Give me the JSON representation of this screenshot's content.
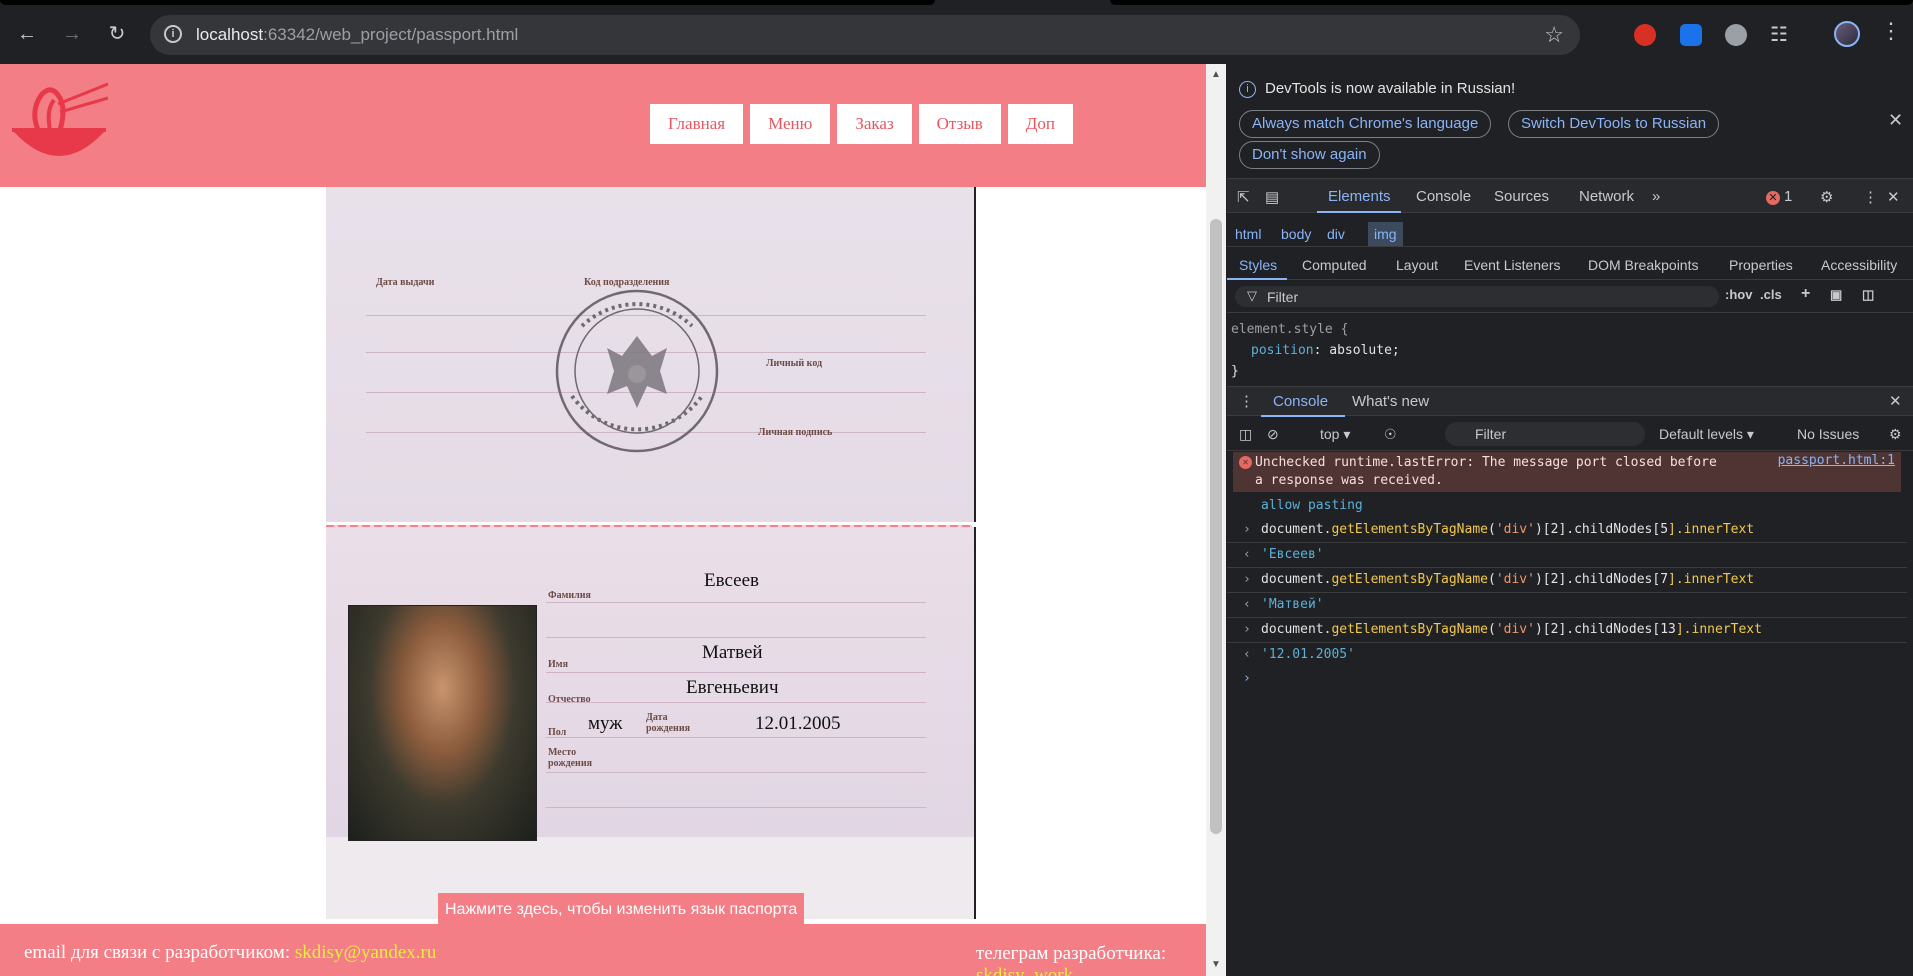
{
  "browser": {
    "url_host": "localhost",
    "url_rest": ":63342/web_project/passport.html"
  },
  "site": {
    "nav": [
      "Главная",
      "Меню",
      "Заказ",
      "Отзыв",
      "Доп"
    ],
    "passport": {
      "labels": {
        "issue_date": "Дата выдачи",
        "division_code": "Код подразделения",
        "personal_code": "Личный код",
        "signature": "Личная подпись",
        "surname": "Фамилия",
        "name": "Имя",
        "patronymic": "Отчество",
        "sex": "Пол",
        "birth_date": "Дата рождения",
        "birth_place": "Место рождения"
      },
      "surname": "Евсеев",
      "name": "Матвей",
      "patronymic": "Евгеньевич",
      "sex": "муж",
      "birth_date": "12.01.2005"
    },
    "lang_button": "Нажмите здесь, чтобы изменить язык паспорта",
    "footer": {
      "email_label": "email для связи с разработчиком: ",
      "email": "skdisy@yandex.ru",
      "telegram_label": "телеграм разработчика:",
      "telegram": "skdisy_work"
    }
  },
  "devtools": {
    "infobar_text": "DevTools is now available in Russian!",
    "btn_match": "Always match Chrome's language",
    "btn_switch": "Switch DevTools to Russian",
    "btn_dont_show": "Don't show again",
    "tabs": [
      "Elements",
      "Console",
      "Sources",
      "Network"
    ],
    "error_count": "1",
    "breadcrumbs": [
      "html",
      "body",
      "div",
      "img"
    ],
    "subtabs": [
      "Styles",
      "Computed",
      "Layout",
      "Event Listeners",
      "DOM Breakpoints",
      "Properties",
      "Accessibility"
    ],
    "filter_placeholder": "Filter",
    "hov": ":hov",
    "cls": ".cls",
    "styles": {
      "selector": "element.style {",
      "prop": "position",
      "value": "absolute;",
      "close": "}"
    },
    "drawer_tabs": [
      "Console",
      "What's new"
    ],
    "console_context": "top",
    "console_filter": "Filter",
    "default_levels": "Default levels",
    "no_issues": "No Issues",
    "console": {
      "error_text_1": "Unchecked runtime.lastError: The message port closed before",
      "error_text_2": "a response was received.",
      "error_link": "passport.html:1",
      "allow_pasting": "allow pasting",
      "cmd_prefix": "document.",
      "cmd_fn": "getElementsByTagName",
      "cmd_arg": "'div'",
      "cmd_mid": ")[2].childNodes[",
      "cmd_suffix": "].innerText",
      "cmd_indexes": [
        "5",
        "7",
        "13"
      ],
      "results": [
        "'Евсеев'",
        "'Матвей'",
        "'12.01.2005'"
      ]
    }
  }
}
